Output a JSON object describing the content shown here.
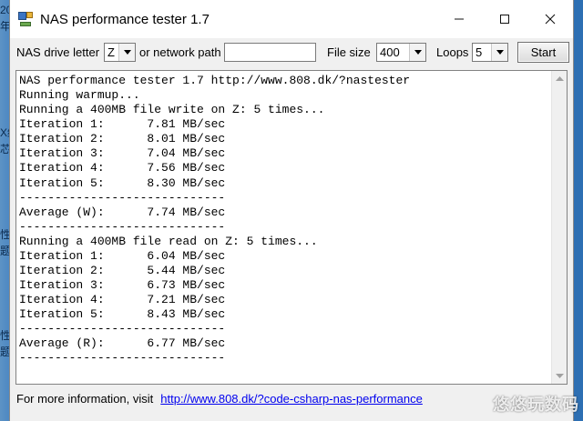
{
  "window": {
    "title": "NAS performance tester 1.7"
  },
  "desktop": {
    "edge_glyphs": [
      "20",
      "年",
      "X终",
      "芯",
      "性",
      "题",
      "性",
      "题"
    ]
  },
  "toolbar": {
    "drive_letter_label": "NAS drive letter",
    "drive_letter_value": "Z",
    "network_path_label": "or network path",
    "network_path_value": "",
    "file_size_label": "File size",
    "file_size_value": "400",
    "loops_label": "Loops",
    "loops_value": "5",
    "start_label": "Start"
  },
  "output": {
    "lines": [
      "NAS performance tester 1.7 http://www.808.dk/?nastester",
      "Running warmup...",
      "Running a 400MB file write on Z: 5 times...",
      "Iteration 1:      7.81 MB/sec",
      "Iteration 2:      8.01 MB/sec",
      "Iteration 3:      7.04 MB/sec",
      "Iteration 4:      7.56 MB/sec",
      "Iteration 5:      8.30 MB/sec",
      "-----------------------------",
      "Average (W):      7.74 MB/sec",
      "-----------------------------",
      "Running a 400MB file read on Z: 5 times...",
      "Iteration 1:      6.04 MB/sec",
      "Iteration 2:      5.44 MB/sec",
      "Iteration 3:      6.73 MB/sec",
      "Iteration 4:      7.21 MB/sec",
      "Iteration 5:      8.43 MB/sec",
      "-----------------------------",
      "Average (R):      6.77 MB/sec",
      "-----------------------------"
    ]
  },
  "footer": {
    "info_text": "For more information, visit",
    "link_text": "http://www.808.dk/?code-csharp-nas-performance"
  },
  "watermark": {
    "text": "悠悠玩数码"
  },
  "icons": {
    "app": "app-icon",
    "minimize": "minimize-icon",
    "maximize": "maximize-icon",
    "close": "close-icon",
    "dropdown": "chevron-down-icon",
    "scroll_up": "scroll-up-icon",
    "scroll_down": "scroll-down-icon"
  }
}
